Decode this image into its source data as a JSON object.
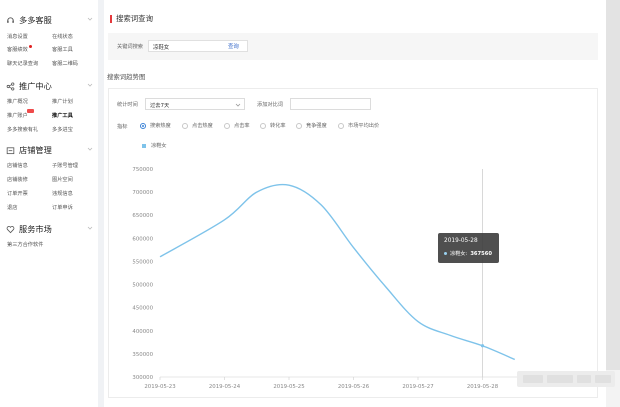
{
  "sidebar": {
    "sections": [
      {
        "title": "多多客服",
        "icon": "headset-icon",
        "links": [
          {
            "label": "消息设置"
          },
          {
            "label": "在线状态"
          },
          {
            "label": "客服绩效",
            "dot": true
          },
          {
            "label": "客服工具"
          },
          {
            "label": "聊天记录查询"
          },
          {
            "label": "客服二维码"
          }
        ]
      },
      {
        "title": "推广中心",
        "icon": "share-icon",
        "links": [
          {
            "label": "推广概况"
          },
          {
            "label": "推广计划"
          },
          {
            "label": "推广账户",
            "badge": true
          },
          {
            "label": "推广工具",
            "active": true
          },
          {
            "label": "多多搜索有礼"
          },
          {
            "label": "多多进宝"
          }
        ]
      },
      {
        "title": "店铺管理",
        "icon": "store-icon",
        "links": [
          {
            "label": "店铺信息"
          },
          {
            "label": "子账号管理"
          },
          {
            "label": "店铺装修"
          },
          {
            "label": "图片空间"
          },
          {
            "label": "订单开票"
          },
          {
            "label": "违规信息"
          },
          {
            "label": "退店"
          },
          {
            "label": "订单申诉"
          }
        ]
      },
      {
        "title": "服务市场",
        "icon": "heart-icon",
        "links": [
          {
            "label": "第三方合作软件"
          }
        ]
      }
    ]
  },
  "page": {
    "title": "搜索词查询",
    "search_label": "关键词搜索",
    "search_value": "凉鞋女",
    "search_button": "查询",
    "trend_title": "搜索词趋势图",
    "time_label": "统计时间",
    "time_value": "过去7天",
    "compare_label": "添加对比词",
    "metric_label": "指标",
    "metrics": [
      {
        "label": "搜索热度",
        "selected": true
      },
      {
        "label": "点击热度",
        "selected": false
      },
      {
        "label": "点击率",
        "selected": false
      },
      {
        "label": "转化率",
        "selected": false
      },
      {
        "label": "竞争强度",
        "selected": false
      },
      {
        "label": "市场平均出价",
        "selected": false
      }
    ]
  },
  "chart_data": {
    "type": "line",
    "series": [
      {
        "name": "凉鞋女",
        "color": "#7ec3ea",
        "points": [
          [
            "2019-05-23",
            560000
          ],
          [
            "2019-05-24",
            640000
          ],
          [
            "2019-05-24 12:00",
            700000
          ],
          [
            "2019-05-25",
            715000
          ],
          [
            "2019-05-25 12:00",
            672000
          ],
          [
            "2019-05-26",
            580000
          ],
          [
            "2019-05-26 12:00",
            495000
          ],
          [
            "2019-05-27",
            420000
          ],
          [
            "2019-05-27 12:00",
            390000
          ],
          [
            "2019-05-28",
            367560
          ],
          [
            "2019-05-28 12:00",
            338000
          ]
        ]
      }
    ],
    "x_ticks": [
      "2019-05-23",
      "2019-05-24",
      "2019-05-25",
      "2019-05-26",
      "2019-05-27",
      "2019-05-28"
    ],
    "y_ticks": [
      "750000",
      "700000",
      "650000",
      "600000",
      "550000",
      "500000",
      "450000",
      "400000",
      "350000",
      "300000"
    ],
    "ylim": [
      300000,
      750000
    ],
    "grid": false,
    "legend": "top-left",
    "tooltip": {
      "date": "2019-05-28",
      "series": "凉鞋女:",
      "value": "367560"
    }
  }
}
